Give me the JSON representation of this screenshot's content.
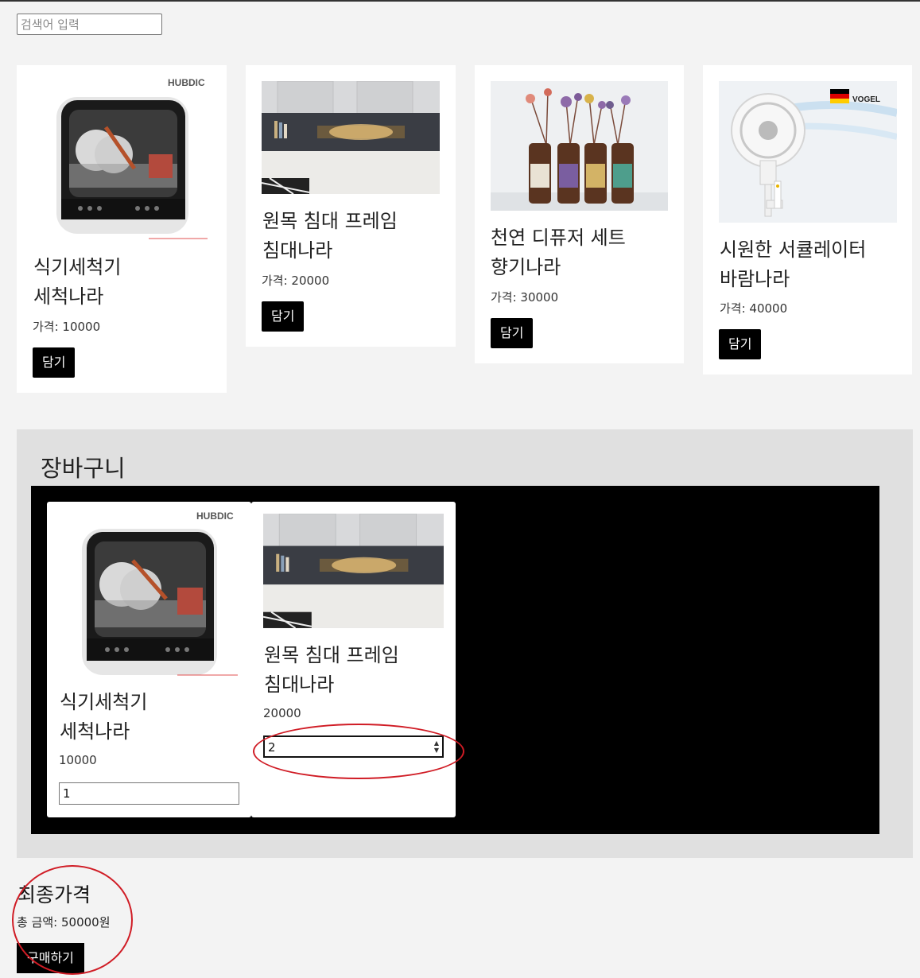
{
  "search": {
    "placeholder": "검색어 입력"
  },
  "products": [
    {
      "title_line1": "식기세척기",
      "title_line2": "세척나라",
      "price_text": "가격: 10000",
      "button_label": "담기",
      "icon": "dishwasher-image"
    },
    {
      "title_line1": "원목 침대 프레임",
      "title_line2": "침대나라",
      "price_text": "가격: 20000",
      "button_label": "담기",
      "icon": "bed-frame-image"
    },
    {
      "title_line1": "천연 디퓨저 세트",
      "title_line2": "향기나라",
      "price_text": "가격: 30000",
      "button_label": "담기",
      "icon": "diffuser-image"
    },
    {
      "title_line1": "시원한 서큘레이터",
      "title_line2": "바람나라",
      "price_text": "가격: 40000",
      "button_label": "담기",
      "icon": "circulator-image"
    }
  ],
  "image_text": {
    "dishwasher_brand": "HUBDIC",
    "circulator_brand": "VOGEL"
  },
  "cart": {
    "title": "장바구니",
    "items": [
      {
        "title_line1": "식기세척기",
        "title_line2": "세척나라",
        "price": "10000",
        "quantity": "1"
      },
      {
        "title_line1": "원목 침대 프레임",
        "title_line2": "침대나라",
        "price": "20000",
        "quantity": "2"
      }
    ]
  },
  "total": {
    "heading": "최종가격",
    "text": "총 금액: 50000원",
    "buy_label": "구매하기"
  },
  "colors": {
    "background": "#f3f3f3",
    "button": "#000000",
    "annotation": "#d01c25"
  }
}
